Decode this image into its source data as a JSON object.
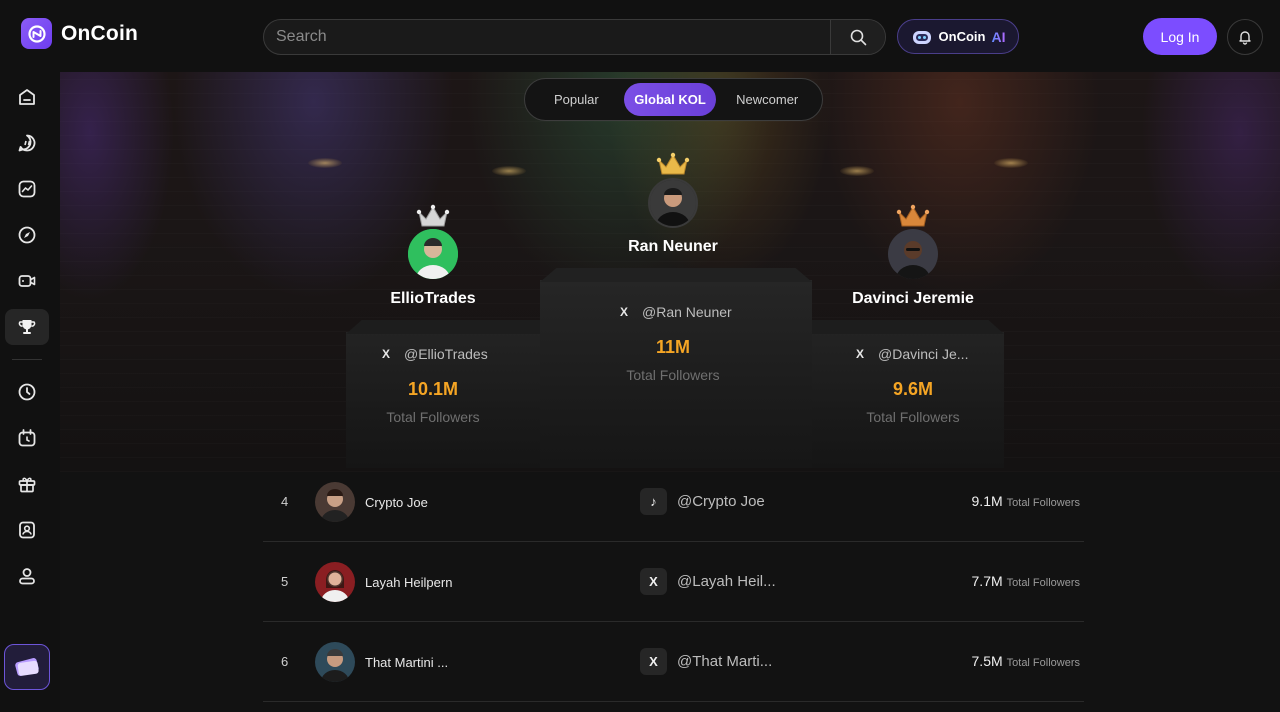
{
  "app": {
    "name": "OnCoin"
  },
  "search": {
    "placeholder": "Search"
  },
  "oncoin_ai": {
    "label": "OnCoin",
    "ai": "AI"
  },
  "login_label": "Log In",
  "sidebar": {
    "items": [
      "home-icon",
      "chat-icon",
      "chart-icon",
      "compass-icon",
      "video-icon",
      "trophy-icon",
      "clock-icon",
      "calendar-icon",
      "gift-icon",
      "id-card-icon",
      "user-icon"
    ],
    "active_item": "trophy-icon"
  },
  "tabs": [
    {
      "label": "Popular"
    },
    {
      "label": "Global KOL",
      "active": true
    },
    {
      "label": "Newcomer"
    }
  ],
  "podium": {
    "first": {
      "name": "Ran Neuner",
      "handle": "@Ran Neuner",
      "followers": "11M",
      "followers_label": "Total Followers",
      "crown_color": "#e9b949",
      "social": "x-icon"
    },
    "second": {
      "name": "EllioTrades",
      "handle": "@EllioTrades",
      "followers": "10.1M",
      "followers_label": "Total Followers",
      "crown_color": "#cfcfcf",
      "social": "x-icon"
    },
    "third": {
      "name": "Davinci Jeremie",
      "handle": "@Davinci Je...",
      "followers": "9.6M",
      "followers_label": "Total Followers",
      "crown_color": "#d9873a",
      "social": "x-icon"
    }
  },
  "list": [
    {
      "rank": "4",
      "name": "Crypto Joe",
      "social": "tiktok-icon",
      "social_glyph": "♪",
      "handle": "@Crypto Joe",
      "followers": "9.1M",
      "followers_label": "Total Followers"
    },
    {
      "rank": "5",
      "name": "Layah Heilpern",
      "social": "x-icon",
      "social_glyph": "X",
      "handle": "@Layah Heil...",
      "followers": "7.7M",
      "followers_label": "Total Followers"
    },
    {
      "rank": "6",
      "name": "That Martini ...",
      "social": "x-icon",
      "social_glyph": "X",
      "handle": "@That Marti...",
      "followers": "7.5M",
      "followers_label": "Total Followers"
    }
  ],
  "colors": {
    "accent": "#7c4dff",
    "gold": "#f5a524"
  }
}
